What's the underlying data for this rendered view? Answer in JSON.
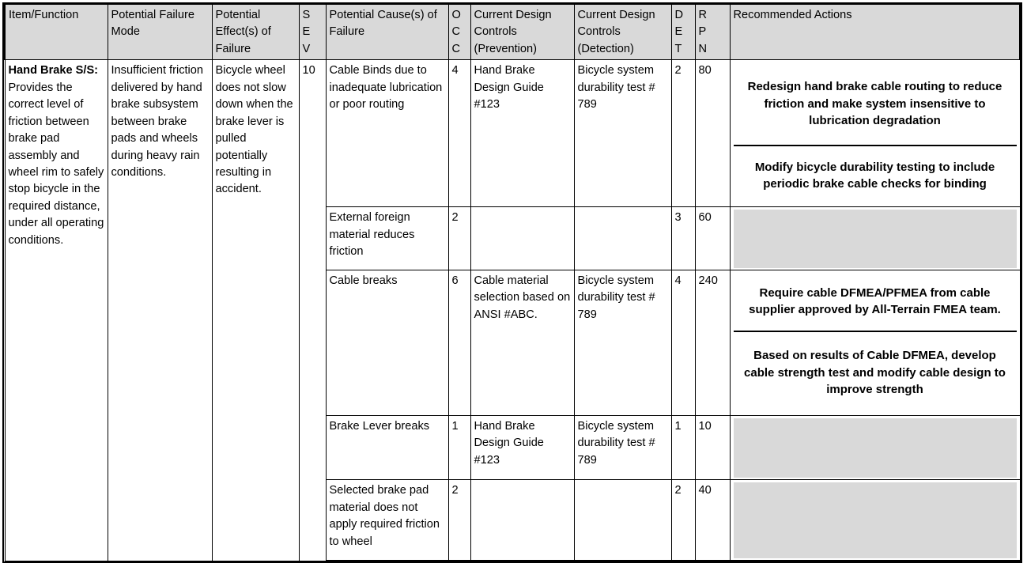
{
  "table": {
    "headers": [
      {
        "id": "item-function",
        "label": "Item/Function",
        "stacked": false
      },
      {
        "id": "potential-failure-mode",
        "label": "Potential Failure Mode",
        "stacked": false
      },
      {
        "id": "potential-effects-of-failure",
        "label": "Potential Effect(s) of Failure",
        "stacked": false
      },
      {
        "id": "sev",
        "label": "S\nE\nV",
        "stacked": true
      },
      {
        "id": "potential-causes-of-failure",
        "label": "Potential Cause(s) of Failure",
        "stacked": false
      },
      {
        "id": "occ",
        "label": "O\nC\nC",
        "stacked": true
      },
      {
        "id": "current-design-controls-prevention",
        "label": "Current Design Controls (Prevention)",
        "stacked": false
      },
      {
        "id": "current-design-controls-detection",
        "label": "Current Design Controls (Detection)",
        "stacked": false
      },
      {
        "id": "det",
        "label": "D\nE\nT",
        "stacked": true
      },
      {
        "id": "rpn",
        "label": "R\nP\nN",
        "stacked": true
      },
      {
        "id": "recommended-actions",
        "label": "Recommended Actions",
        "stacked": false
      }
    ],
    "item_function": {
      "lead": "Hand Brake S/S:",
      "text": " Provides the correct level of friction between brake pad assembly and wheel rim to safely stop bicycle in the required distance, under all operating conditions."
    },
    "failure_mode": "Insufficient friction delivered by hand brake subsystem between brake pads and wheels during heavy rain conditions.",
    "effect": "Bicycle wheel does not slow down when the brake lever is pulled potentially resulting in accident.",
    "severity": "10",
    "causes": [
      {
        "cause": "Cable Binds due to inadequate lubrication or poor routing",
        "occ": "4",
        "prevention": "Hand Brake Design Guide #123",
        "detection": "Bicycle system durability test # 789",
        "det": "2",
        "rpn": "80",
        "actions": [
          "Redesign hand brake cable routing to reduce friction and make system insensitive to lubrication degradation",
          "Modify bicycle durability testing to include periodic brake cable checks for binding"
        ]
      },
      {
        "cause": "External foreign material reduces friction",
        "occ": "2",
        "prevention": "",
        "detection": "",
        "det": "3",
        "rpn": "60",
        "actions": [
          ""
        ]
      },
      {
        "cause": "Cable breaks",
        "occ": "6",
        "prevention": "Cable material selection based on ANSI #ABC.",
        "detection": "Bicycle system durability test # 789",
        "det": "4",
        "rpn": "240",
        "actions": [
          "Require cable DFMEA/PFMEA from cable supplier approved by All-Terrain FMEA team.",
          "Based on results of Cable DFMEA, develop cable strength test and modify cable design to improve strength"
        ]
      },
      {
        "cause": "Brake Lever breaks",
        "occ": "1",
        "prevention": "Hand Brake Design Guide #123",
        "detection": "Bicycle system durability test # 789",
        "det": "1",
        "rpn": "10",
        "actions": [
          ""
        ]
      },
      {
        "cause": "Selected brake pad material does not apply required friction to wheel",
        "occ": "2",
        "prevention": "",
        "detection": "",
        "det": "2",
        "rpn": "40",
        "actions": [
          ""
        ]
      }
    ]
  },
  "colors": {
    "header_fill": "#d9d9d9",
    "empty_action_fill": "#d9d9d9",
    "border": "#000000",
    "text": "#000000",
    "page_background": "#ffffff"
  }
}
